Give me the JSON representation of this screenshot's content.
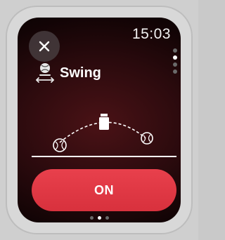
{
  "status": {
    "time": "15:03"
  },
  "header": {
    "close_icon": "close-icon"
  },
  "mode": {
    "title": "Swing",
    "icon": "swing-mode-icon"
  },
  "action": {
    "label": "ON",
    "color": "#e33a46"
  },
  "vertical_pager": {
    "count": 4,
    "active_index": 1
  },
  "horizontal_pager": {
    "count": 3,
    "active_index": 1
  },
  "colors": {
    "background_center": "#4a1216",
    "background_edge": "#060203",
    "button": "#e33a46",
    "text": "#ffffff"
  }
}
